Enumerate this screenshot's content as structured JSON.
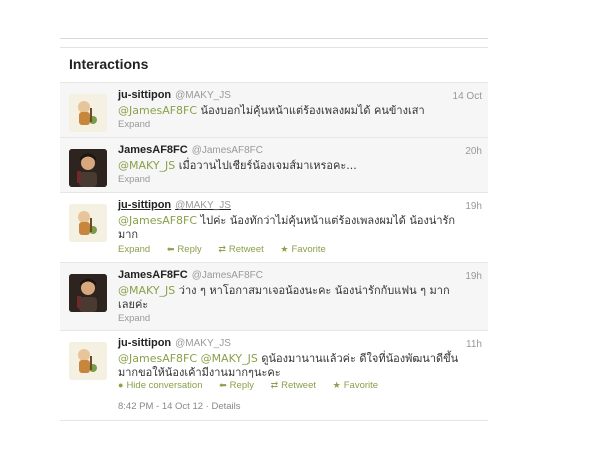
{
  "header": {
    "title": "Interactions"
  },
  "tweets": [
    {
      "name": "ju-sittipon",
      "handle": "@MAKY_JS",
      "time": "14 Oct",
      "mention": "@JamesAF8FC",
      "text": " น้องบอกไม่คุ้นหน้าแต่ร้องเพลงผมได้ คนข้างเสา",
      "actions": [
        "Expand"
      ]
    },
    {
      "name": "JamesAF8FC",
      "handle": "@JamesAF8FC",
      "time": "20h",
      "mention": "@MAKY_JS",
      "text": " เมื่อวานไปเชียร์น้องเจมส์มาเหรอคะ...",
      "actions": [
        "Expand"
      ]
    },
    {
      "name": "ju-sittipon",
      "handle": "@MAKY_JS",
      "time": "19h",
      "mention": "@JamesAF8FC",
      "text": " ไปค่ะ น้องทักว่าไม่คุ้นหน้าแต่ร้องเพลงผมได้ น้องน่ารักมาก",
      "actions": [
        "Expand",
        "Reply",
        "Retweet",
        "Favorite"
      ]
    },
    {
      "name": "JamesAF8FC",
      "handle": "@JamesAF8FC",
      "time": "19h",
      "mention": "@MAKY_JS",
      "text": " ว่าง ๆ หาโอกาสมาเจอน้องนะคะ น้องน่ารักกับแฟน ๆ มากเลยค่ะ",
      "actions": [
        "Expand"
      ]
    },
    {
      "name": "ju-sittipon",
      "handle": "@MAKY_JS",
      "time": "11h",
      "mention": "@JamesAF8FC",
      "mention2": "@MAKY_JS",
      "text": " ดูน้องมานานแล้วค่ะ ดีใจที่น้องพัฒนาดีขึ้นมากขอให้น้องเค้ามีงานมากๆนะคะ",
      "actions": [
        "Hide conversation",
        "Reply",
        "Retweet",
        "Favorite"
      ],
      "meta": "8:42 PM - 14 Oct 12",
      "details": "Details"
    }
  ],
  "colors": {
    "accent": "#8aa04a",
    "muted": "#999999",
    "row_shade": "#f6f6f6"
  },
  "icons": {
    "reply": "reply-arrow-icon",
    "retweet": "retweet-icon",
    "favorite": "star-icon",
    "hide": "conversation-bubble-icon"
  }
}
